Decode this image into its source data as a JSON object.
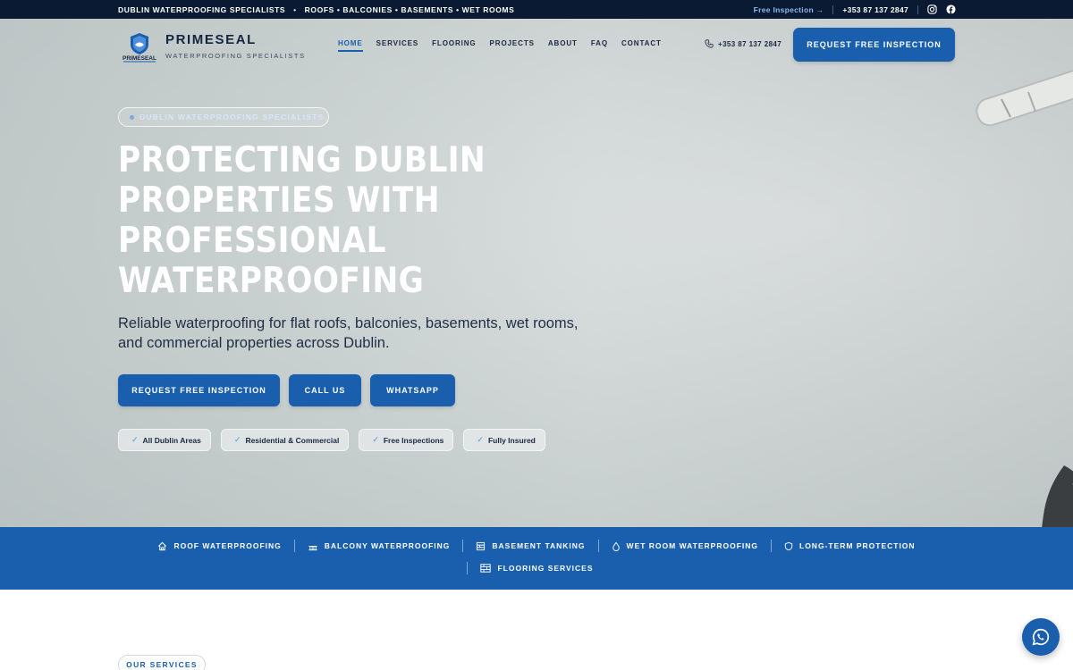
{
  "topbar": {
    "tagline": "DUBLIN WATERPROOFING SPECIALISTS",
    "services_line": "ROOFS • BALCONIES • BASEMENTS • WET ROOMS",
    "free_inspection_link": "Free Inspection →",
    "phone": "+353 87 137 2847",
    "social_icons": [
      "instagram-icon",
      "facebook-icon"
    ]
  },
  "header": {
    "brand_name": "PRIMESEAL",
    "brand_tagline": "WATERPROOFING SPECIALISTS",
    "logo_text": "PRIMESEAL",
    "nav": [
      "HOME",
      "SERVICES",
      "FLOORING",
      "PROJECTS",
      "ABOUT",
      "FAQ",
      "CONTACT"
    ],
    "active_nav": "HOME",
    "phone": "+353 87 137 2847",
    "cta_label": "REQUEST FREE INSPECTION"
  },
  "hero": {
    "pill_label": "DUBLIN WATERPROOFING SPECIALISTS",
    "headline_lines": [
      "PROTECTING DUBLIN",
      "PROPERTIES WITH",
      "PROFESSIONAL",
      "WATERPROOFING"
    ],
    "subheadline": "Reliable waterproofing for flat roofs, balconies, basements, wet rooms, and commercial properties across Dublin.",
    "buttons": [
      "REQUEST FREE INSPECTION",
      "CALL US",
      "WHATSAPP"
    ],
    "chips": [
      "All Dublin Areas",
      "Residential & Commercial",
      "Free Inspections",
      "Fully Insured"
    ]
  },
  "service_band": {
    "items": [
      {
        "label": "ROOF WATERPROOFING",
        "icon": "house-icon"
      },
      {
        "label": "BALCONY WATERPROOFING",
        "icon": "balcony-icon"
      },
      {
        "label": "BASEMENT TANKING",
        "icon": "layers-icon"
      },
      {
        "label": "WET ROOM WATERPROOFING",
        "icon": "droplet-icon"
      },
      {
        "label": "LONG-TERM PROTECTION",
        "icon": "shield-icon"
      },
      {
        "label": "FLOORING SERVICES",
        "icon": "grid-icon"
      }
    ]
  },
  "section": {
    "label": "OUR SERVICES"
  },
  "colors": {
    "accent": "#1a5fae",
    "topbar_bg": "#0b1a33",
    "band_bg": "#1a5fae"
  }
}
